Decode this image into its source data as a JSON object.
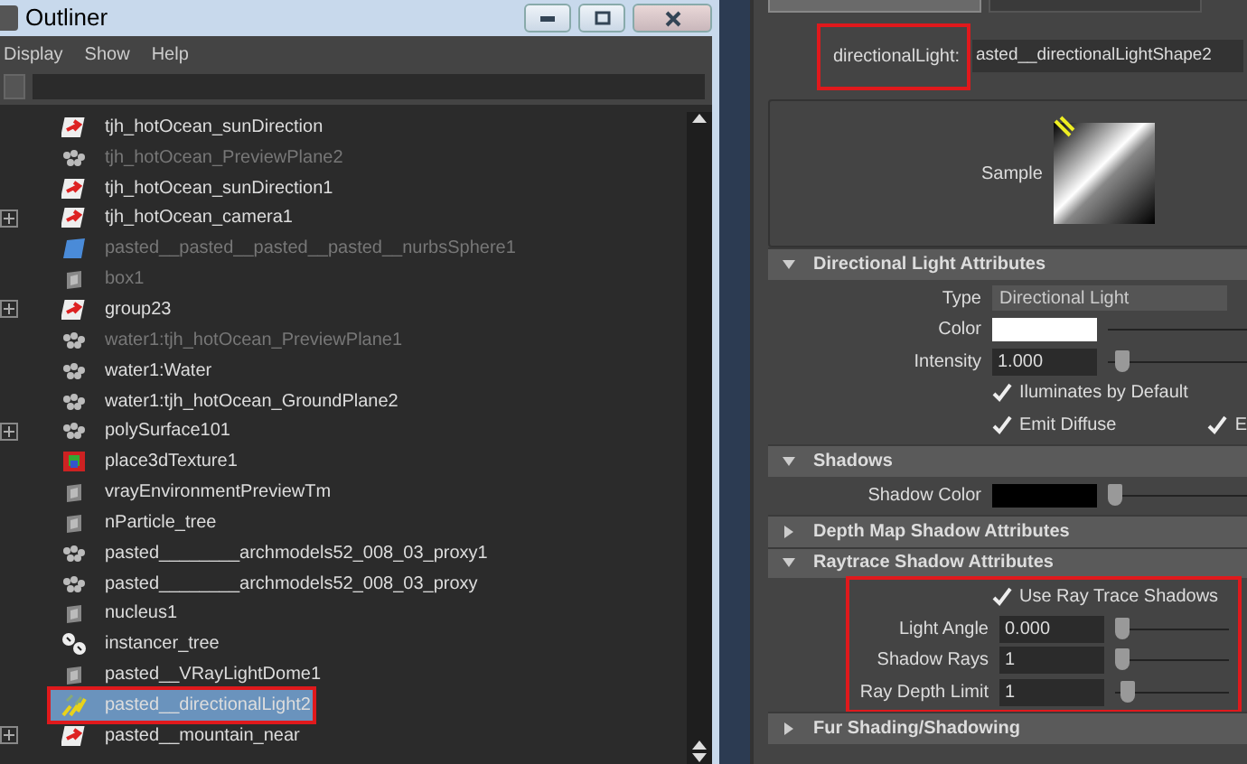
{
  "outliner": {
    "title": "Outliner",
    "menu": [
      "Display",
      "Show",
      "Help"
    ],
    "items": [
      {
        "label": "tjh_hotOcean_sunDirection",
        "kind": "locator",
        "dimmed": false,
        "expandable": false,
        "selected": false,
        "highlighted": false
      },
      {
        "label": "tjh_hotOcean_PreviewPlane2",
        "kind": "mesh",
        "dimmed": true,
        "expandable": false,
        "selected": false,
        "highlighted": false
      },
      {
        "label": "tjh_hotOcean_sunDirection1",
        "kind": "locator",
        "dimmed": false,
        "expandable": false,
        "selected": false,
        "highlighted": false
      },
      {
        "label": "tjh_hotOcean_camera1",
        "kind": "locator",
        "dimmed": false,
        "expandable": true,
        "selected": false,
        "highlighted": false
      },
      {
        "label": "pasted__pasted__pasted__pasted__nurbsSphere1",
        "kind": "nurbs",
        "dimmed": true,
        "expandable": false,
        "selected": false,
        "highlighted": false
      },
      {
        "label": "box1",
        "kind": "node",
        "dimmed": true,
        "expandable": false,
        "selected": false,
        "highlighted": false
      },
      {
        "label": "group23",
        "kind": "locator",
        "dimmed": false,
        "expandable": true,
        "selected": false,
        "highlighted": false
      },
      {
        "label": "water1:tjh_hotOcean_PreviewPlane1",
        "kind": "mesh",
        "dimmed": true,
        "expandable": false,
        "selected": false,
        "highlighted": false
      },
      {
        "label": "water1:Water",
        "kind": "mesh",
        "dimmed": false,
        "expandable": false,
        "selected": false,
        "highlighted": false
      },
      {
        "label": "water1:tjh_hotOcean_GroundPlane2",
        "kind": "mesh",
        "dimmed": false,
        "expandable": false,
        "selected": false,
        "highlighted": false
      },
      {
        "label": "polySurface101",
        "kind": "mesh",
        "dimmed": false,
        "expandable": true,
        "selected": false,
        "highlighted": false
      },
      {
        "label": "place3dTexture1",
        "kind": "texture",
        "dimmed": false,
        "expandable": false,
        "selected": false,
        "highlighted": false
      },
      {
        "label": "vrayEnvironmentPreviewTm",
        "kind": "node",
        "dimmed": false,
        "expandable": false,
        "selected": false,
        "highlighted": false
      },
      {
        "label": "nParticle_tree",
        "kind": "node",
        "dimmed": false,
        "expandable": false,
        "selected": false,
        "highlighted": false
      },
      {
        "label": "pasted________archmodels52_008_03_proxy1",
        "kind": "mesh",
        "dimmed": false,
        "expandable": false,
        "selected": false,
        "highlighted": false
      },
      {
        "label": "pasted________archmodels52_008_03_proxy",
        "kind": "mesh",
        "dimmed": false,
        "expandable": false,
        "selected": false,
        "highlighted": false
      },
      {
        "label": "nucleus1",
        "kind": "node",
        "dimmed": false,
        "expandable": false,
        "selected": false,
        "highlighted": false
      },
      {
        "label": "instancer_tree",
        "kind": "instancer",
        "dimmed": false,
        "expandable": false,
        "selected": false,
        "highlighted": false
      },
      {
        "label": "pasted__VRayLightDome1",
        "kind": "node",
        "dimmed": false,
        "expandable": false,
        "selected": false,
        "highlighted": false
      },
      {
        "label": "pasted__directionalLight2",
        "kind": "light",
        "dimmed": false,
        "expandable": false,
        "selected": true,
        "highlighted": true
      },
      {
        "label": "pasted__mountain_near",
        "kind": "locator",
        "dimmed": false,
        "expandable": true,
        "selected": false,
        "highlighted": false
      }
    ]
  },
  "attribute_editor": {
    "tabs": [
      {
        "selected": true
      },
      {
        "selected": false
      }
    ],
    "node_label": "directionalLight:",
    "node_label_highlighted": true,
    "node_name": "asted__directionalLightShape2",
    "sample_label": "Sample",
    "sections": [
      {
        "title": "Directional Light Attributes",
        "expanded": true,
        "rows": [
          {
            "kind": "dropdown",
            "label": "Type",
            "value": "Directional Light"
          },
          {
            "kind": "swatch",
            "label": "Color",
            "color": "#ffffff"
          },
          {
            "kind": "field",
            "label": "Intensity",
            "value": "1.000",
            "level": 0.06
          },
          {
            "kind": "checkbox",
            "label": "Iluminates by Default",
            "checked": true
          },
          {
            "kind": "checkbox-pair",
            "items": [
              {
                "label": "Emit Diffuse",
                "checked": true
              },
              {
                "label": "E",
                "checked": true
              }
            ]
          }
        ]
      },
      {
        "title": "Shadows",
        "expanded": true,
        "rows": [
          {
            "kind": "swatch",
            "label": "Shadow Color",
            "color": "#000000",
            "level": 0.0
          }
        ]
      },
      {
        "title": "Depth Map Shadow Attributes",
        "expanded": false
      },
      {
        "title": "Raytrace Shadow Attributes",
        "expanded": true,
        "rows_highlighted": true,
        "rows": [
          {
            "kind": "checkbox",
            "label": "Use Ray Trace Shadows",
            "checked": true
          },
          {
            "kind": "field",
            "label": "Light Angle",
            "value": "0.000",
            "level": 0.0
          },
          {
            "kind": "field",
            "label": "Shadow Rays",
            "value": "1",
            "level": 0.0
          },
          {
            "kind": "field",
            "label": "Ray Depth Limit",
            "value": "1",
            "level": 0.05
          }
        ]
      },
      {
        "title": "Fur Shading/Shadowing",
        "expanded": false
      }
    ]
  }
}
